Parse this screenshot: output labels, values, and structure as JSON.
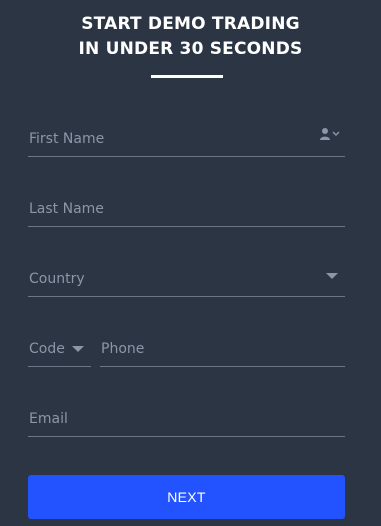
{
  "header": {
    "title_line1": "START DEMO TRADING",
    "title_line2": "IN UNDER 30 SECONDS"
  },
  "form": {
    "first_name_placeholder": "First Name",
    "last_name_placeholder": "Last Name",
    "country_placeholder": "Country",
    "code_placeholder": "Code",
    "phone_placeholder": "Phone",
    "email_placeholder": "Email",
    "autofill_icon": "user-autofill-icon",
    "dropdown_icon": "caret-down-icon"
  },
  "actions": {
    "next_label": "NEXT"
  },
  "colors": {
    "background": "#2b3544",
    "accent": "#2353ff",
    "text": "#ffffff",
    "placeholder": "#8b96a8",
    "divider": "#6b7788"
  }
}
